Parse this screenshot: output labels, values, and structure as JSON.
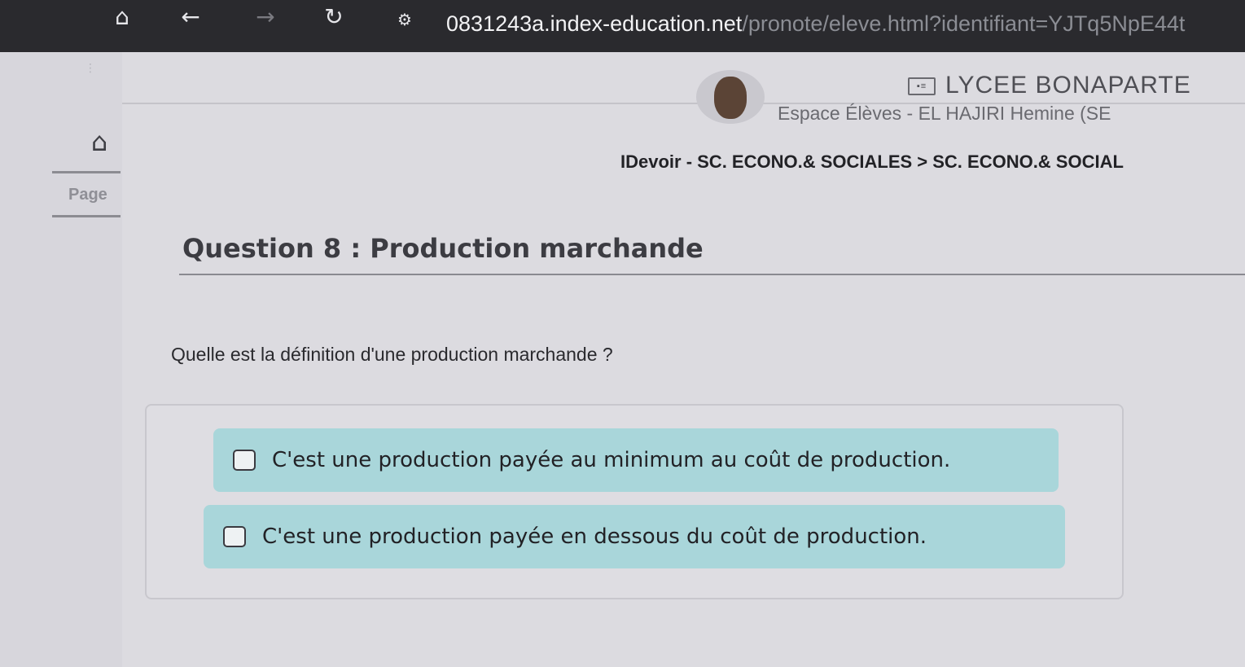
{
  "browser": {
    "url_host": "0831243a.index-education.net",
    "url_path": "/pronote/eleve.html?identifiant=YJTq5NpE44t",
    "icons": [
      "home-icon",
      "back-icon",
      "forward-icon",
      "reload-icon",
      "site-settings-icon"
    ]
  },
  "header": {
    "school": "LYCEE BONAPARTE",
    "space": "Espace Élèves - EL HAJIRI Hemine (SE",
    "icons": [
      "id-card-icon",
      "avatar"
    ]
  },
  "sidebar": {
    "page_label": "Page",
    "icons": [
      "home-icon"
    ]
  },
  "breadcrumb": "IDevoir - SC. ECONO.& SOCIALES > SC. ECONO.& SOCIAL",
  "question": {
    "title": "Question 8 : Production marchande",
    "text": "Quelle est la définition d'une production marchande ?",
    "answers": [
      {
        "label": "C'est une production payée au minimum au coût de production.",
        "checked": false
      },
      {
        "label": "C'est une production payée en dessous du coût de production.",
        "checked": false
      }
    ]
  },
  "colors": {
    "answer_bg": "#a9d6da",
    "page_bg": "#dcdbe0",
    "chrome_bg": "#2a2a2e"
  }
}
